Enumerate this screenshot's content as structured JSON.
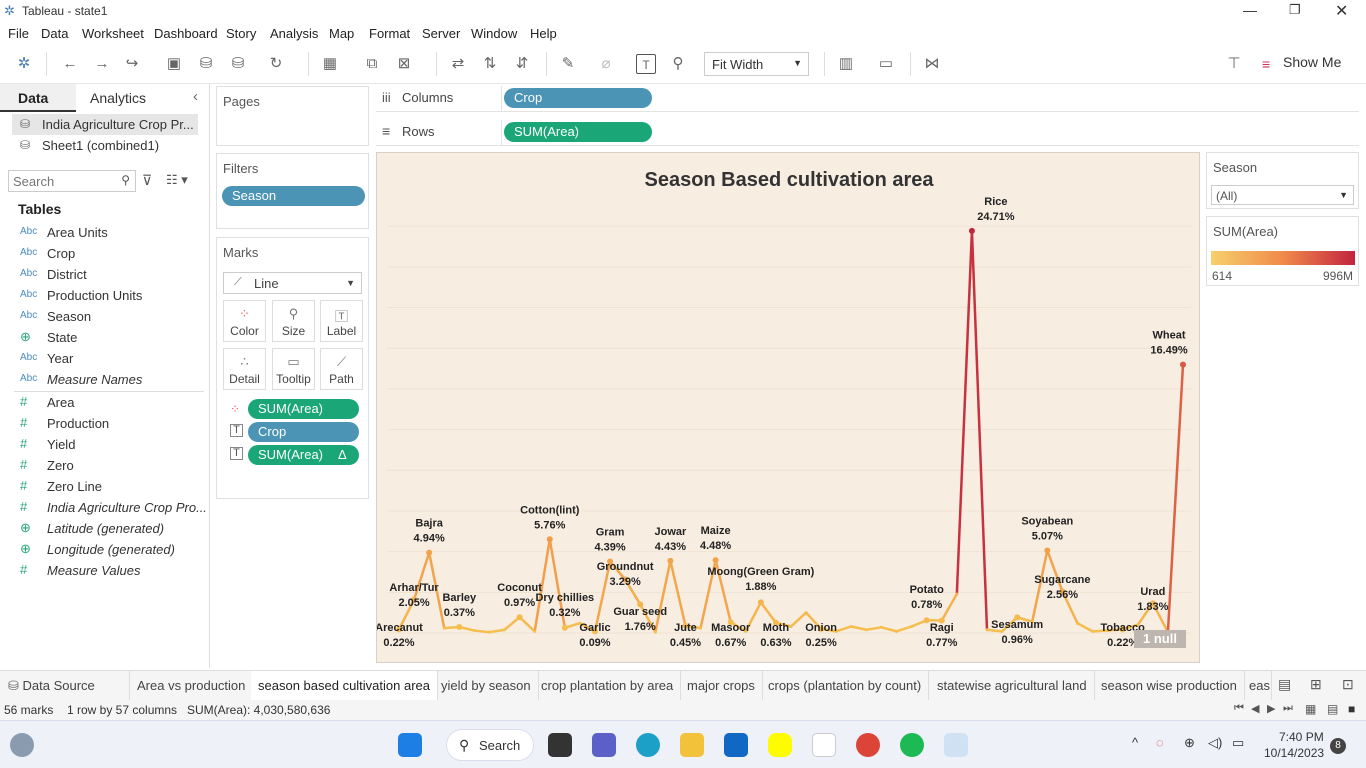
{
  "window": {
    "title": "Tableau - state1"
  },
  "menu": [
    "File",
    "Data",
    "Worksheet",
    "Dashboard",
    "Story",
    "Analysis",
    "Map",
    "Format",
    "Server",
    "Window",
    "Help"
  ],
  "toolbar": {
    "fit": "Fit Width",
    "show_me": "Show Me"
  },
  "left_tabs": {
    "data": "Data",
    "analytics": "Analytics"
  },
  "datasources": [
    "India Agriculture Crop Pr...",
    "Sheet1 (combined1)"
  ],
  "search": {
    "placeholder": "Search"
  },
  "tables_header": "Tables",
  "fields": [
    {
      "type": "Abc",
      "name": "Area Units"
    },
    {
      "type": "Abc",
      "name": "Crop"
    },
    {
      "type": "Abc",
      "name": "District"
    },
    {
      "type": "Abc",
      "name": "Production Units"
    },
    {
      "type": "Abc",
      "name": "Season"
    },
    {
      "type": "globe",
      "name": "State"
    },
    {
      "type": "Abc",
      "name": "Year"
    },
    {
      "type": "Abc",
      "name": "Measure Names",
      "italic": true
    }
  ],
  "measures": [
    {
      "type": "#",
      "name": "Area"
    },
    {
      "type": "#",
      "name": "Production"
    },
    {
      "type": "#",
      "name": "Yield"
    },
    {
      "type": "#",
      "name": "Zero"
    },
    {
      "type": "#",
      "name": "Zero Line"
    },
    {
      "type": "#",
      "name": "India Agriculture Crop Pro...",
      "italic": true
    },
    {
      "type": "globe",
      "name": "Latitude (generated)",
      "italic": true
    },
    {
      "type": "globe",
      "name": "Longitude (generated)",
      "italic": true
    },
    {
      "type": "#",
      "name": "Measure Values",
      "italic": true
    }
  ],
  "pages_label": "Pages",
  "filters": {
    "label": "Filters",
    "pill": "Season"
  },
  "marks": {
    "label": "Marks",
    "type": "Line",
    "buttons": [
      "Color",
      "Size",
      "Label",
      "Detail",
      "Tooltip",
      "Path"
    ],
    "pills": [
      "SUM(Area)",
      "Crop",
      "SUM(Area)"
    ],
    "delta": "Δ"
  },
  "shelves": {
    "columns_label": "Columns",
    "columns_pill": "Crop",
    "rows_label": "Rows",
    "rows_pill": "SUM(Area)"
  },
  "legend": {
    "season_title": "Season",
    "season_value": "(All)",
    "color_title": "SUM(Area)",
    "min": "614",
    "max": "996M",
    "color_low": "#f6d06b",
    "color_high": "#c3243e"
  },
  "chart_data": {
    "type": "line",
    "title": "Season Based cultivation area",
    "xlabel": "",
    "ylabel": "",
    "null_badge": "1 null",
    "points": [
      {
        "crop": "Arecanut",
        "value": 0.22,
        "label": true
      },
      {
        "crop": "Arhar/Tur",
        "value": 2.05,
        "label": true
      },
      {
        "crop": "Bajra",
        "value": 4.94,
        "label": true
      },
      {
        "crop": "",
        "value": 0.3
      },
      {
        "crop": "Barley",
        "value": 0.37,
        "label": true
      },
      {
        "crop": "",
        "value": 0.15
      },
      {
        "crop": "",
        "value": 0.05
      },
      {
        "crop": "",
        "value": 0.2
      },
      {
        "crop": "Coconut",
        "value": 0.97,
        "label": true
      },
      {
        "crop": "",
        "value": 0.1
      },
      {
        "crop": "Cotton(lint)",
        "value": 5.76,
        "label": true
      },
      {
        "crop": "Dry chillies",
        "value": 0.32,
        "label": true
      },
      {
        "crop": "",
        "value": 0.6
      },
      {
        "crop": "Garlic",
        "value": 0.09,
        "label": true
      },
      {
        "crop": "Gram",
        "value": 4.39,
        "label": true
      },
      {
        "crop": "Groundnut",
        "value": 3.29,
        "label": true
      },
      {
        "crop": "Guar seed",
        "value": 1.76,
        "label": true
      },
      {
        "crop": "",
        "value": 0.05
      },
      {
        "crop": "Jowar",
        "value": 4.43,
        "label": true
      },
      {
        "crop": "Jute",
        "value": 0.45,
        "label": true
      },
      {
        "crop": "",
        "value": 0.3
      },
      {
        "crop": "Maize",
        "value": 4.48,
        "label": true
      },
      {
        "crop": "Masoor",
        "value": 0.67,
        "label": true
      },
      {
        "crop": "",
        "value": 0.1
      },
      {
        "crop": "Moong(Green Gram)",
        "value": 1.88,
        "label": true
      },
      {
        "crop": "Moth",
        "value": 0.63,
        "label": true
      },
      {
        "crop": "",
        "value": 0.4
      },
      {
        "crop": "",
        "value": 1.25
      },
      {
        "crop": "Onion",
        "value": 0.25,
        "label": true
      },
      {
        "crop": "",
        "value": 0.1
      },
      {
        "crop": "",
        "value": 0.4
      },
      {
        "crop": "",
        "value": 0.2
      },
      {
        "crop": "",
        "value": 0.35
      },
      {
        "crop": "",
        "value": 0.1
      },
      {
        "crop": "",
        "value": 0.4
      },
      {
        "crop": "Potato",
        "value": 0.78,
        "label": true
      },
      {
        "crop": "Ragi",
        "value": 0.77,
        "label": true
      },
      {
        "crop": "",
        "value": 2.4
      },
      {
        "crop": "Rice",
        "value": 24.71,
        "label": true
      },
      {
        "crop": "",
        "value": 0.2
      },
      {
        "crop": "",
        "value": 0.1
      },
      {
        "crop": "Sesamum",
        "value": 0.96,
        "label": true
      },
      {
        "crop": "",
        "value": 0.7
      },
      {
        "crop": "Soyabean",
        "value": 5.07,
        "label": true
      },
      {
        "crop": "Sugarcane",
        "value": 2.56,
        "label": true
      },
      {
        "crop": "",
        "value": 0.6
      },
      {
        "crop": "",
        "value": 0.1
      },
      {
        "crop": "",
        "value": 0.15
      },
      {
        "crop": "Tobacco",
        "value": 0.22,
        "label": true
      },
      {
        "crop": "",
        "value": 0.5
      },
      {
        "crop": "Urad",
        "value": 1.83,
        "label": true
      },
      {
        "crop": "",
        "value": 0.05
      },
      {
        "crop": "Wheat",
        "value": 16.49,
        "label": true
      }
    ],
    "ylim": [
      0,
      25.5
    ]
  },
  "sheet_tabs": [
    "Data Source",
    "Area vs production",
    "season based cultivation area",
    "yield by season",
    "crop plantation by area",
    "major crops",
    "crops (plantation by count)",
    "statewise agricultural land",
    "season wise production",
    "eas"
  ],
  "status": {
    "marks": "56 marks",
    "rows": "1 row by 57 columns",
    "sum": "SUM(Area): 4,030,580,636"
  },
  "taskbar": {
    "search": "Search",
    "time": "7:40 PM",
    "date": "10/14/2023",
    "notifications": "8"
  }
}
